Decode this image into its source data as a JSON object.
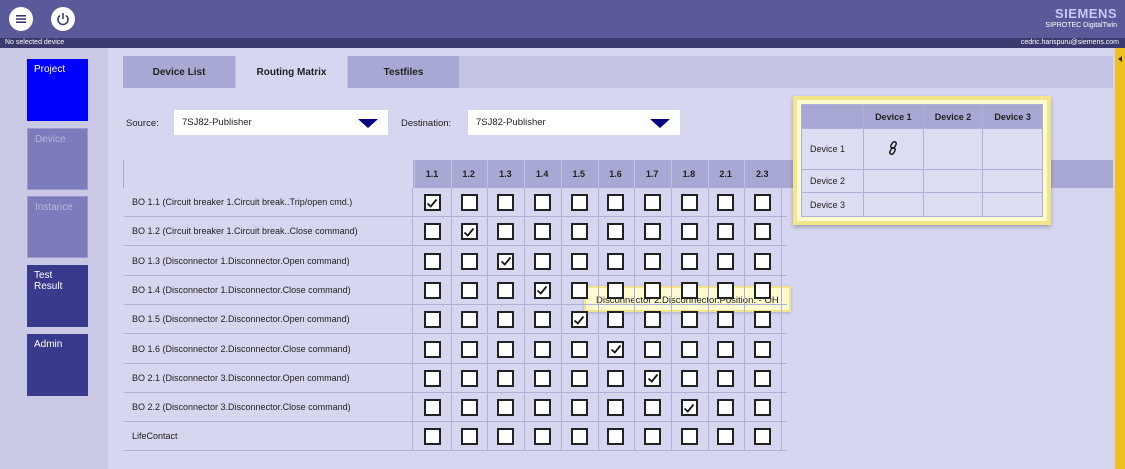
{
  "header": {
    "brand": "SIEMENS",
    "app_name": "SIPROTEC DigitalTwin",
    "status_left": "No selected device",
    "user_email": "cedric.harispuru@siemens.com"
  },
  "sidenav": {
    "items": [
      {
        "label": "Project",
        "state": "active"
      },
      {
        "label": "Device",
        "state": "disabled"
      },
      {
        "label": "Instance",
        "state": "disabled"
      },
      {
        "label": "Test Result",
        "state": "normal"
      },
      {
        "label": "Admin",
        "state": "normal"
      }
    ]
  },
  "tabs": [
    {
      "label": "Device List"
    },
    {
      "label": "Routing Matrix",
      "active": true
    },
    {
      "label": "Testfiles"
    }
  ],
  "source": {
    "label": "Source:",
    "value": "7SJ82-Publisher"
  },
  "destination": {
    "label": "Destination:",
    "value": "7SJ82-Publisher"
  },
  "matrix": {
    "columns": [
      "1.1",
      "1.2",
      "1.3",
      "1.4",
      "1.5",
      "1.6",
      "1.7",
      "1.8",
      "2.1",
      "2.3"
    ],
    "rows": [
      {
        "label": "BO 1.1 (Circuit breaker 1.Circuit break..Trip/open cmd.)",
        "checked": [
          0
        ]
      },
      {
        "label": "BO 1.2 (Circuit breaker 1.Circuit break..Close command)",
        "checked": [
          1
        ]
      },
      {
        "label": "BO 1.3 (Disconnector 1.Disconnector.Open command)",
        "checked": [
          2
        ]
      },
      {
        "label": "BO 1.4 (Disconnector 1.Disconnector.Close command)",
        "checked": [
          3
        ]
      },
      {
        "label": "BO 1.5 (Disconnector 2.Disconnector.Open command)",
        "checked": [
          4
        ]
      },
      {
        "label": "BO 1.6 (Disconnector 2.Disconnector.Close command)",
        "checked": [
          5
        ]
      },
      {
        "label": "BO 2.1 (Disconnector 3.Disconnector.Open command)",
        "checked": [
          6
        ]
      },
      {
        "label": "BO 2.2 (Disconnector 3.Disconnector.Close command)",
        "checked": [
          7
        ]
      },
      {
        "label": "LifeContact",
        "checked": []
      }
    ]
  },
  "tooltip": {
    "text": "Disconnector 2.Disconnector.Position. - OH"
  },
  "device_popup": {
    "columns": [
      "Device 1",
      "Device 2",
      "Device 3"
    ],
    "rows": [
      {
        "label": "Device 1",
        "linked": [
          0
        ]
      },
      {
        "label": "Device 2",
        "linked": []
      },
      {
        "label": "Device 3",
        "linked": []
      }
    ],
    "link_icon": "link-icon"
  },
  "colors": {
    "header": "#5a5a9a",
    "active_nav": "#0000ff",
    "nav": "#3a3a8c",
    "accent": "#f0c020",
    "tooltip_bg": "#fffbd0"
  }
}
